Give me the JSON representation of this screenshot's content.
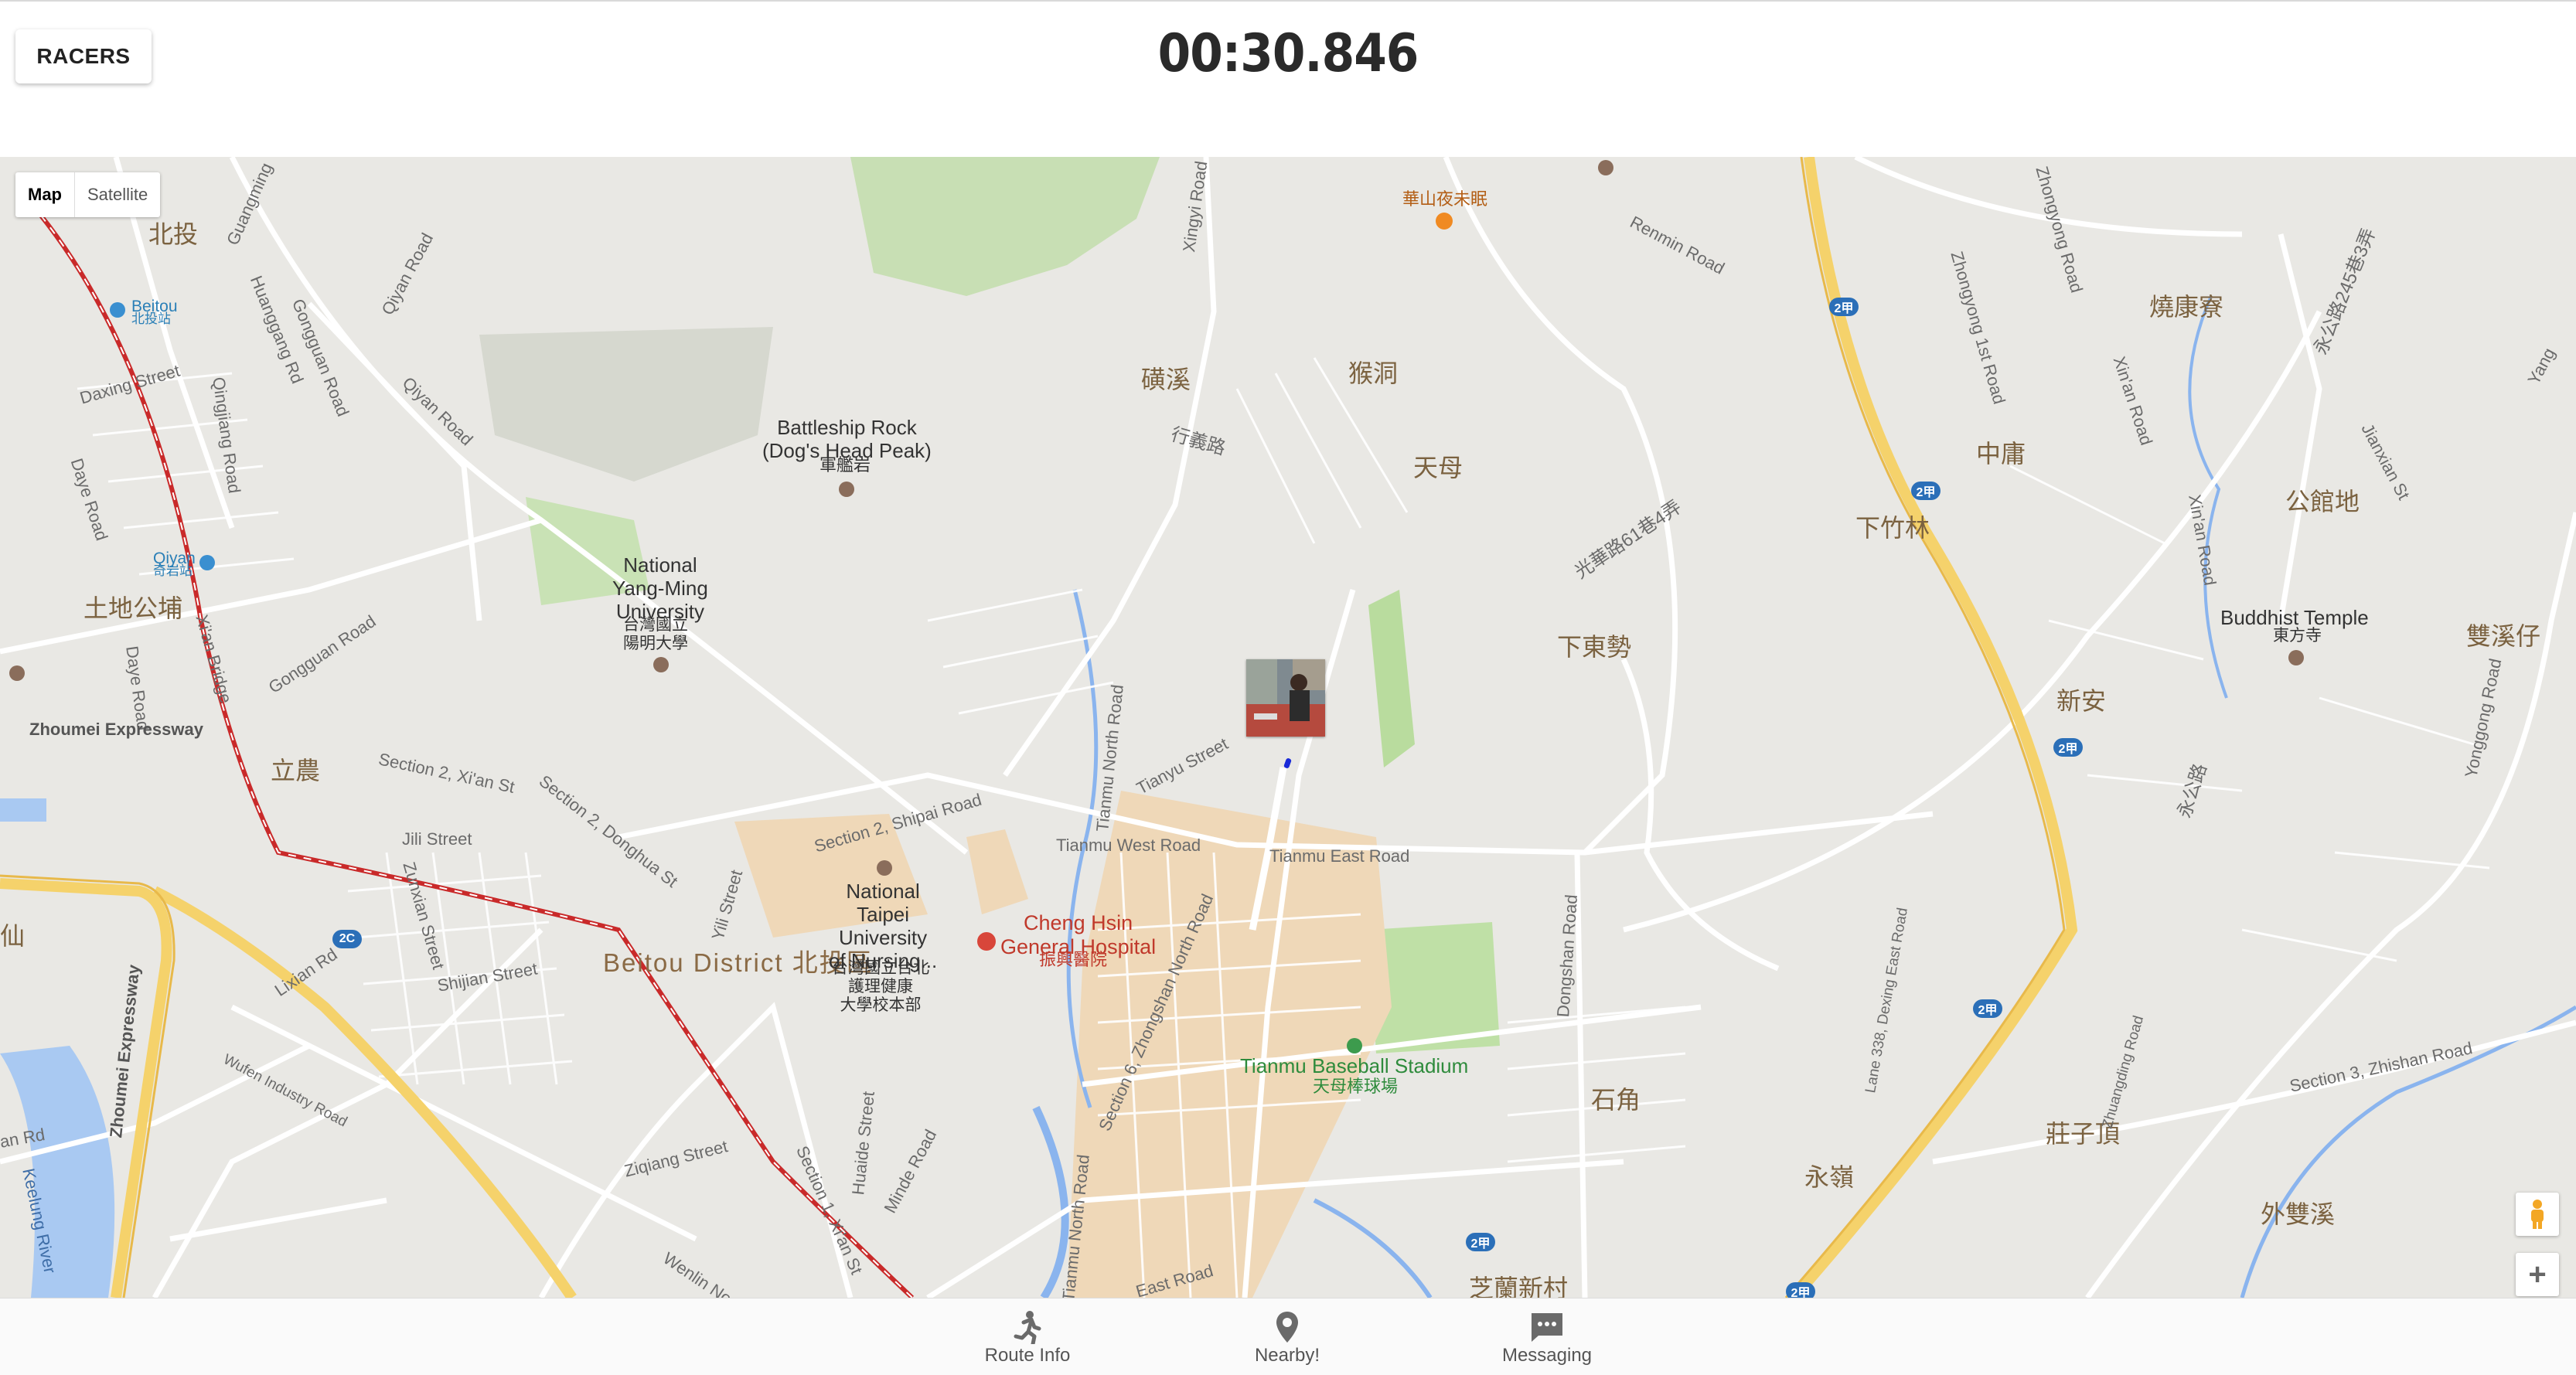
{
  "header": {
    "racers_button": "RACERS",
    "timer": "00:30.846"
  },
  "map": {
    "map_type": {
      "map": "Map",
      "satellite": "Satellite"
    },
    "districts": {
      "beitou_en": "Beitou District",
      "beitou_zh": "北投區"
    },
    "places_zh": {
      "beitou": "北投",
      "tudigongpu": "土地公埔",
      "lishan": "立農",
      "xian": "仙",
      "qixi": "磺溪",
      "houdong": "猴洞",
      "tianmu": "天母",
      "xiadongshi": "下東勢",
      "zhongyong": "中庸",
      "xiazhulin": "下竹林",
      "gongguandi": "公館地",
      "xinan": "新安",
      "shiqiao": "石角",
      "yongling": "永嶺",
      "zhuangziding": "莊子頂",
      "waishuangxi": "外雙溪",
      "shaokangliao": "燒康寮",
      "shuangxizai": "雙溪仔",
      "zhilanxincun": "芝蘭新村"
    },
    "pois": {
      "battleship_rock_en": "Battleship Rock\n(Dog's Head Peak)",
      "battleship_rock_zh": "軍艦岩",
      "ymu_en": "National\nYang-Ming\nUniversity",
      "ymu_zh": "台灣國立\n陽明大學",
      "ntunhs_en": "National\nTaipei\nUniversity\nof Nursing...",
      "ntunhs_zh": "台灣國立台北\n護理健康\n大學校本部",
      "hospital_en": "Cheng Hsin\nGeneral Hospital",
      "hospital_zh": "振興醫院",
      "stadium_en": "Tianmu Baseball Stadium",
      "stadium_zh": "天母棒球場",
      "temple_en": "Buddhist Temple",
      "temple_zh": "東方寺",
      "restaurant_zh": "華山夜未眠",
      "beitou_station_en": "Beitou",
      "beitou_station_zh": "北投站",
      "qiyan_station_en": "Qiyan",
      "qiyan_station_zh": "奇岩站"
    },
    "roads": {
      "daxing": "Daxing Street",
      "guangming": "Guangming",
      "huanggang": "Huanggang Rd",
      "gongguan1": "Gongguan Road",
      "qiyan1": "Qiyan Road",
      "qiyan2": "Qiyan Road",
      "qingjiang": "Qingjiang Road",
      "daye1": "Daye Road",
      "daye2": "Daye Road",
      "xian_bridge": "Xi'an Bridge",
      "gongguan2": "Gongguan Road",
      "zhoumei1": "Zhoumei Expressway",
      "zhoumei2": "Zhoumei Expressway",
      "xian_st": "Section 2, Xi'an St",
      "donghua": "Section 2, Donghua St",
      "jili": "Jili Street",
      "zunxian": "Zunxian Street",
      "shijian": "Shijian Street",
      "lixian": "Lixian Rd",
      "wufen": "Wufen Industry Road",
      "keelung": "Keelung River",
      "yili": "Yili Street",
      "shipai": "Section 2, Shipai Road",
      "tianmu_west": "Tianmu West Road",
      "tianmu_east": "Tianmu East Road",
      "tianmu_north1": "Tianmu North Road",
      "tianmu_north2": "Tianmu North Road",
      "tianyu": "Tianyu Street",
      "zhongshan": "Section 6, Zhongshan North Road",
      "xingyi": "Xingyi Road",
      "xingyi_zh": "行義路",
      "dongshan": "Dongshan Road",
      "ziqiang": "Ziqiang Street",
      "huaide": "Huaide Street",
      "mingde": "Minde Road",
      "xian_st1": "Section 1, Xi'an St",
      "wenlin": "Wenlin No",
      "renmin": "Renmin Road",
      "zhongyong_rd": "Zhongyong 1st Road",
      "zhongyong2": "Zhongyong Road",
      "xinan_rd": "Xin'an Road",
      "xinan_rd2": "Xin'an Road",
      "jianxian": "Jianxian St",
      "yonggong": "Yonggong Road",
      "dexing": "Lane 338, Dexing East Road",
      "zhuangding": "Zhuangding Road",
      "zhishan": "Section 3, Zhishan Road",
      "guangdian_zh": "光華路61巷4弄",
      "yonggong_zh": "永公路245巷3弄",
      "yonggong_zh2": "永公路",
      "east_rd": "East Road",
      "an_rd": "an Rd",
      "yang": "Yang"
    },
    "shields": [
      "2",
      "2甲",
      "2甲",
      "2甲",
      "2甲",
      "2甲",
      "2甲"
    ],
    "route_shield_2c": "2C"
  },
  "bottom_nav": {
    "items": [
      {
        "label": "Route Info",
        "icon": "runner-icon"
      },
      {
        "label": "Nearby!",
        "icon": "location-pin-icon"
      },
      {
        "label": "Messaging",
        "icon": "chat-icon"
      }
    ]
  }
}
